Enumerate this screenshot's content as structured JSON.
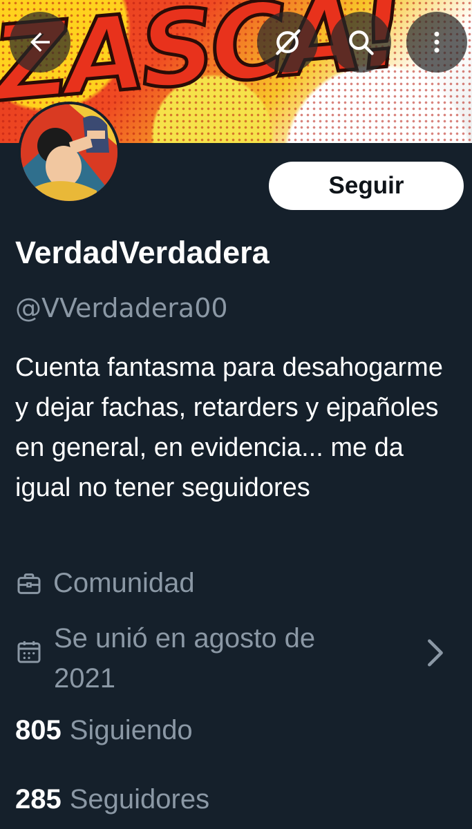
{
  "banner": {
    "text": "ZASCA!"
  },
  "header_buttons": {
    "back": "back-arrow-icon",
    "grok": "grok-icon",
    "search": "search-icon",
    "more": "more-vertical-icon"
  },
  "follow_button": {
    "label": "Seguir"
  },
  "profile": {
    "display_name": "VerdadVerdadera",
    "handle": "@VVerdadera00",
    "bio": "Cuenta fantasma para desahogarme y dejar fachas, retarders y ejpañoles en general, en evidencia... me da igual no tener seguidores",
    "category": "Comunidad",
    "joined": "Se unió en agosto de 2021"
  },
  "stats": {
    "following_count": "805",
    "following_label": "Siguiendo",
    "followers_count": "285",
    "followers_label": "Seguidores"
  },
  "colors": {
    "background": "#15202b",
    "secondary_text": "#8b98a5",
    "button_bg": "#ffffff"
  }
}
